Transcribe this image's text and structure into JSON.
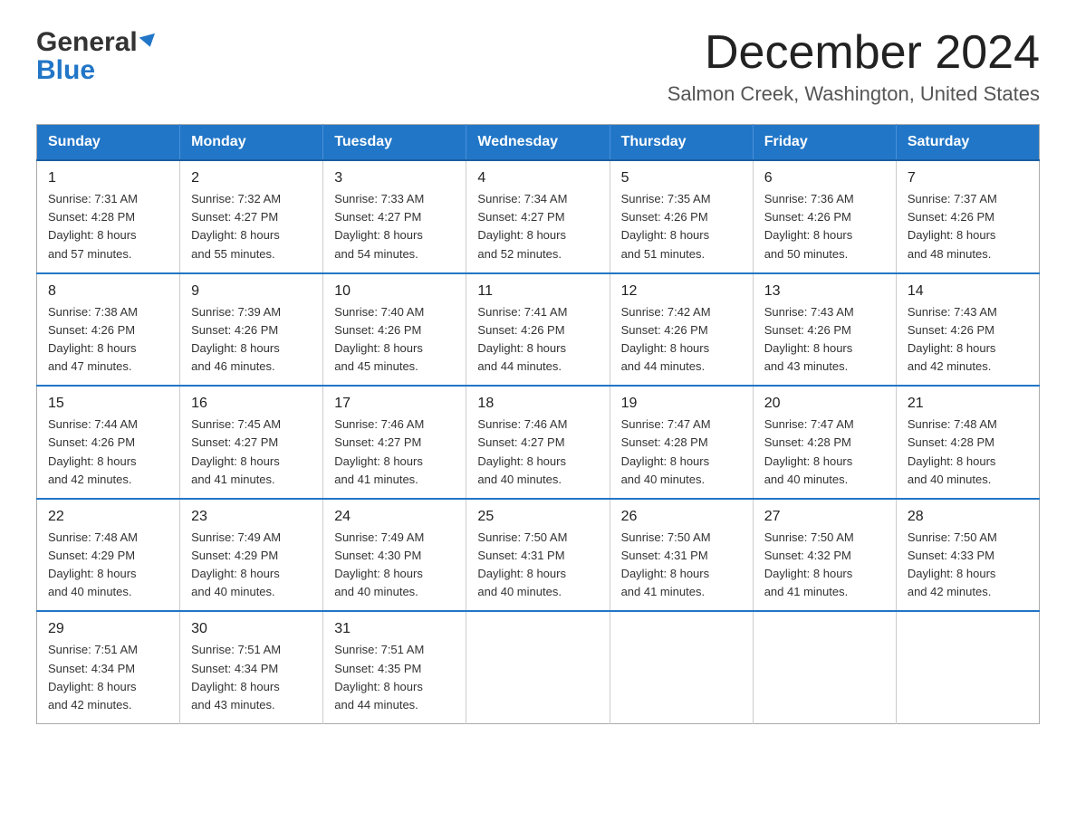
{
  "logo": {
    "text_general": "General",
    "text_blue": "Blue"
  },
  "header": {
    "month": "December 2024",
    "location": "Salmon Creek, Washington, United States"
  },
  "weekdays": [
    "Sunday",
    "Monday",
    "Tuesday",
    "Wednesday",
    "Thursday",
    "Friday",
    "Saturday"
  ],
  "weeks": [
    [
      {
        "day": "1",
        "sunrise": "7:31 AM",
        "sunset": "4:28 PM",
        "daylight": "8 hours and 57 minutes."
      },
      {
        "day": "2",
        "sunrise": "7:32 AM",
        "sunset": "4:27 PM",
        "daylight": "8 hours and 55 minutes."
      },
      {
        "day": "3",
        "sunrise": "7:33 AM",
        "sunset": "4:27 PM",
        "daylight": "8 hours and 54 minutes."
      },
      {
        "day": "4",
        "sunrise": "7:34 AM",
        "sunset": "4:27 PM",
        "daylight": "8 hours and 52 minutes."
      },
      {
        "day": "5",
        "sunrise": "7:35 AM",
        "sunset": "4:26 PM",
        "daylight": "8 hours and 51 minutes."
      },
      {
        "day": "6",
        "sunrise": "7:36 AM",
        "sunset": "4:26 PM",
        "daylight": "8 hours and 50 minutes."
      },
      {
        "day": "7",
        "sunrise": "7:37 AM",
        "sunset": "4:26 PM",
        "daylight": "8 hours and 48 minutes."
      }
    ],
    [
      {
        "day": "8",
        "sunrise": "7:38 AM",
        "sunset": "4:26 PM",
        "daylight": "8 hours and 47 minutes."
      },
      {
        "day": "9",
        "sunrise": "7:39 AM",
        "sunset": "4:26 PM",
        "daylight": "8 hours and 46 minutes."
      },
      {
        "day": "10",
        "sunrise": "7:40 AM",
        "sunset": "4:26 PM",
        "daylight": "8 hours and 45 minutes."
      },
      {
        "day": "11",
        "sunrise": "7:41 AM",
        "sunset": "4:26 PM",
        "daylight": "8 hours and 44 minutes."
      },
      {
        "day": "12",
        "sunrise": "7:42 AM",
        "sunset": "4:26 PM",
        "daylight": "8 hours and 44 minutes."
      },
      {
        "day": "13",
        "sunrise": "7:43 AM",
        "sunset": "4:26 PM",
        "daylight": "8 hours and 43 minutes."
      },
      {
        "day": "14",
        "sunrise": "7:43 AM",
        "sunset": "4:26 PM",
        "daylight": "8 hours and 42 minutes."
      }
    ],
    [
      {
        "day": "15",
        "sunrise": "7:44 AM",
        "sunset": "4:26 PM",
        "daylight": "8 hours and 42 minutes."
      },
      {
        "day": "16",
        "sunrise": "7:45 AM",
        "sunset": "4:27 PM",
        "daylight": "8 hours and 41 minutes."
      },
      {
        "day": "17",
        "sunrise": "7:46 AM",
        "sunset": "4:27 PM",
        "daylight": "8 hours and 41 minutes."
      },
      {
        "day": "18",
        "sunrise": "7:46 AM",
        "sunset": "4:27 PM",
        "daylight": "8 hours and 40 minutes."
      },
      {
        "day": "19",
        "sunrise": "7:47 AM",
        "sunset": "4:28 PM",
        "daylight": "8 hours and 40 minutes."
      },
      {
        "day": "20",
        "sunrise": "7:47 AM",
        "sunset": "4:28 PM",
        "daylight": "8 hours and 40 minutes."
      },
      {
        "day": "21",
        "sunrise": "7:48 AM",
        "sunset": "4:28 PM",
        "daylight": "8 hours and 40 minutes."
      }
    ],
    [
      {
        "day": "22",
        "sunrise": "7:48 AM",
        "sunset": "4:29 PM",
        "daylight": "8 hours and 40 minutes."
      },
      {
        "day": "23",
        "sunrise": "7:49 AM",
        "sunset": "4:29 PM",
        "daylight": "8 hours and 40 minutes."
      },
      {
        "day": "24",
        "sunrise": "7:49 AM",
        "sunset": "4:30 PM",
        "daylight": "8 hours and 40 minutes."
      },
      {
        "day": "25",
        "sunrise": "7:50 AM",
        "sunset": "4:31 PM",
        "daylight": "8 hours and 40 minutes."
      },
      {
        "day": "26",
        "sunrise": "7:50 AM",
        "sunset": "4:31 PM",
        "daylight": "8 hours and 41 minutes."
      },
      {
        "day": "27",
        "sunrise": "7:50 AM",
        "sunset": "4:32 PM",
        "daylight": "8 hours and 41 minutes."
      },
      {
        "day": "28",
        "sunrise": "7:50 AM",
        "sunset": "4:33 PM",
        "daylight": "8 hours and 42 minutes."
      }
    ],
    [
      {
        "day": "29",
        "sunrise": "7:51 AM",
        "sunset": "4:34 PM",
        "daylight": "8 hours and 42 minutes."
      },
      {
        "day": "30",
        "sunrise": "7:51 AM",
        "sunset": "4:34 PM",
        "daylight": "8 hours and 43 minutes."
      },
      {
        "day": "31",
        "sunrise": "7:51 AM",
        "sunset": "4:35 PM",
        "daylight": "8 hours and 44 minutes."
      },
      null,
      null,
      null,
      null
    ]
  ],
  "labels": {
    "sunrise": "Sunrise:",
    "sunset": "Sunset:",
    "daylight": "Daylight:"
  }
}
